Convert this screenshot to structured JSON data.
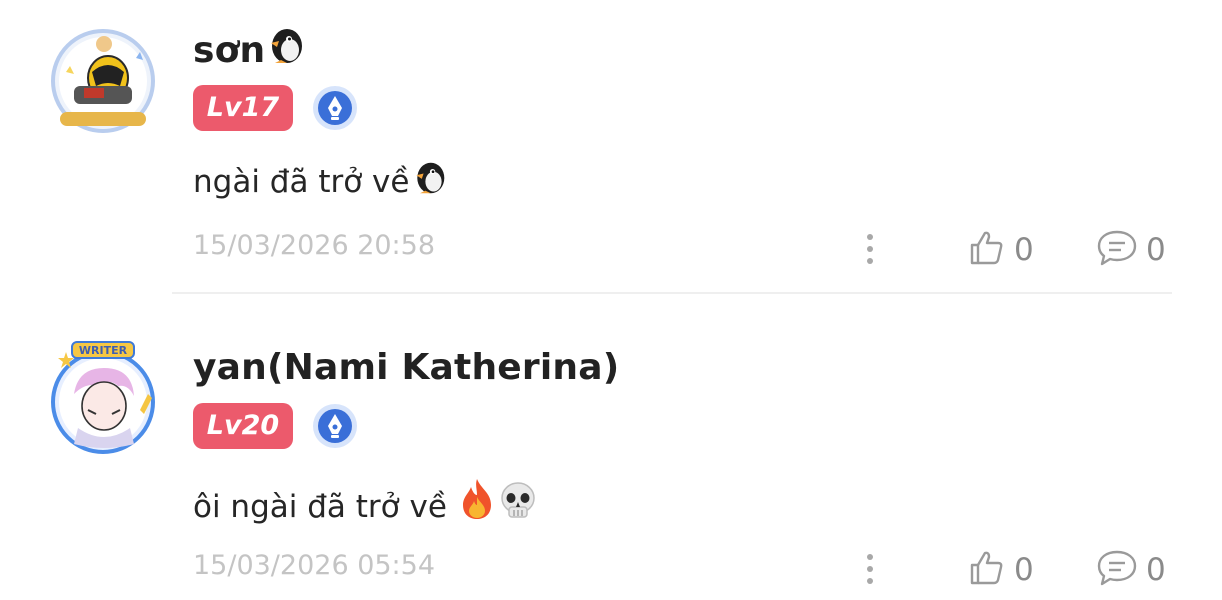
{
  "comments": [
    {
      "username": "sơn",
      "level": "Lv17",
      "content": "ngài đã trở về",
      "content_emoji": [
        "penguin"
      ],
      "timestamp": "15/03/2026 20:58",
      "likes": "0",
      "replies": "0",
      "avatar_frame_text": "",
      "colors": {
        "level_badge": "#ec5a6c",
        "writer_badge": "#3a6fd8"
      }
    },
    {
      "username": "yan(Nami Katherina)",
      "level": "Lv20",
      "content": "ôi ngài đã trở về",
      "content_emoji": [
        "fire",
        "skull"
      ],
      "timestamp": "15/03/2026 05:54",
      "likes": "0",
      "replies": "0",
      "avatar_frame_text": "WRITER",
      "colors": {
        "level_badge": "#ec5a6c",
        "writer_badge": "#3a6fd8"
      }
    }
  ],
  "icons": {
    "more": "more-vertical-icon",
    "like": "thumbs-up-icon",
    "reply": "comment-bubble-icon",
    "writer": "pen-nib-icon"
  }
}
